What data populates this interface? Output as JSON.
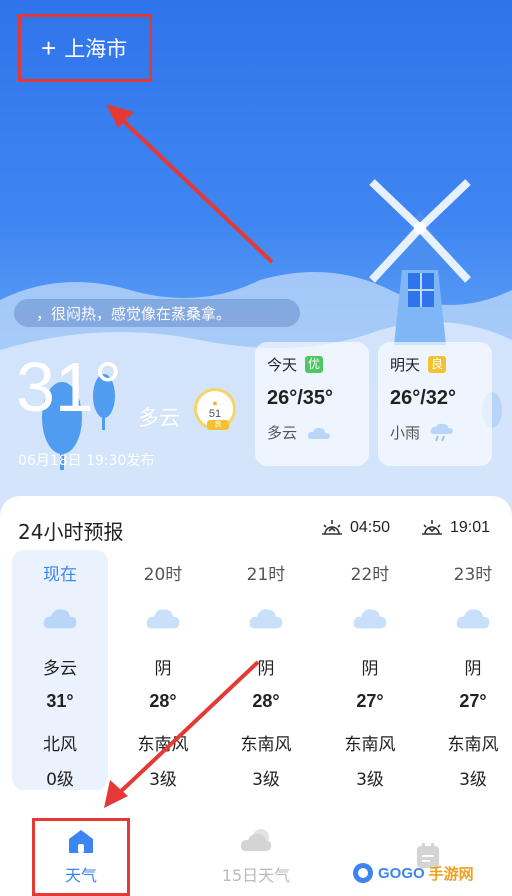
{
  "header": {
    "add_symbol": "+",
    "city": "上海市"
  },
  "current": {
    "tip": "，很闷热，感觉像在蒸桑拿。",
    "temperature": "31°",
    "condition": "多云",
    "aqi_value": "51",
    "aqi_level": "良",
    "publish_time": "06月18日 19:30发布"
  },
  "days": [
    {
      "label": "今天",
      "quality": "优",
      "quality_color": "#4cc964",
      "range": "26°/35°",
      "condition": "多云",
      "icon": "cloud-icon"
    },
    {
      "label": "明天",
      "quality": "良",
      "quality_color": "#f2c230",
      "range": "26°/32°",
      "condition": "小雨",
      "icon": "rain-icon"
    }
  ],
  "forecast": {
    "title": "24小时预报",
    "sunrise": "04:50",
    "sunset": "19:01",
    "hours": [
      {
        "time": "现在",
        "condition": "多云",
        "temp": "31°",
        "wind": "北风",
        "level": "0级"
      },
      {
        "time": "20时",
        "condition": "阴",
        "temp": "28°",
        "wind": "东南风",
        "level": "3级"
      },
      {
        "time": "21时",
        "condition": "阴",
        "temp": "28°",
        "wind": "东南风",
        "level": "3级"
      },
      {
        "time": "22时",
        "condition": "阴",
        "temp": "27°",
        "wind": "东南风",
        "level": "3级"
      },
      {
        "time": "23时",
        "condition": "阴",
        "temp": "27°",
        "wind": "东南风",
        "level": "3级"
      }
    ]
  },
  "nav": {
    "weather": "天气",
    "fifteen_day": "15日天气"
  },
  "watermark": {
    "brand_a": "GOGO",
    "brand_b": "手游网",
    "url": "www.gogo.cn"
  },
  "colors": {
    "accent": "#3d85f0",
    "annotation": "#e53935"
  }
}
